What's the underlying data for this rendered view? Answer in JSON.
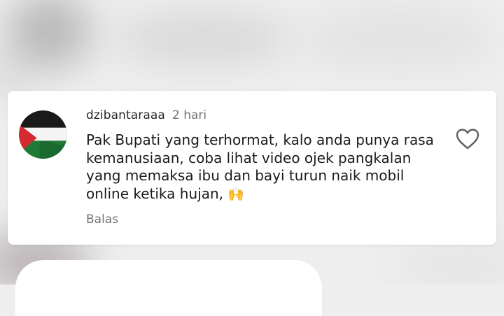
{
  "comment": {
    "username": "dzibantaraaa",
    "time": "2 hari",
    "text": "Pak Bupati yang terhormat, kalo anda punya rasa kemanusiaan, coba lihat video ojek pangkalan yang memaksa ibu dan bayi turun naik mobil online ketika hujan,",
    "emoji": "🙌",
    "reply_label": "Balas",
    "avatar_icon": "palestine-flag-icon",
    "like_icon": "heart-outline-icon"
  },
  "colors": {
    "background": "#eeeeee",
    "card": "#ffffff",
    "username": "#262626",
    "muted": "#737373",
    "flag_red": "#d22a2f",
    "flag_green": "#1f7a37"
  }
}
